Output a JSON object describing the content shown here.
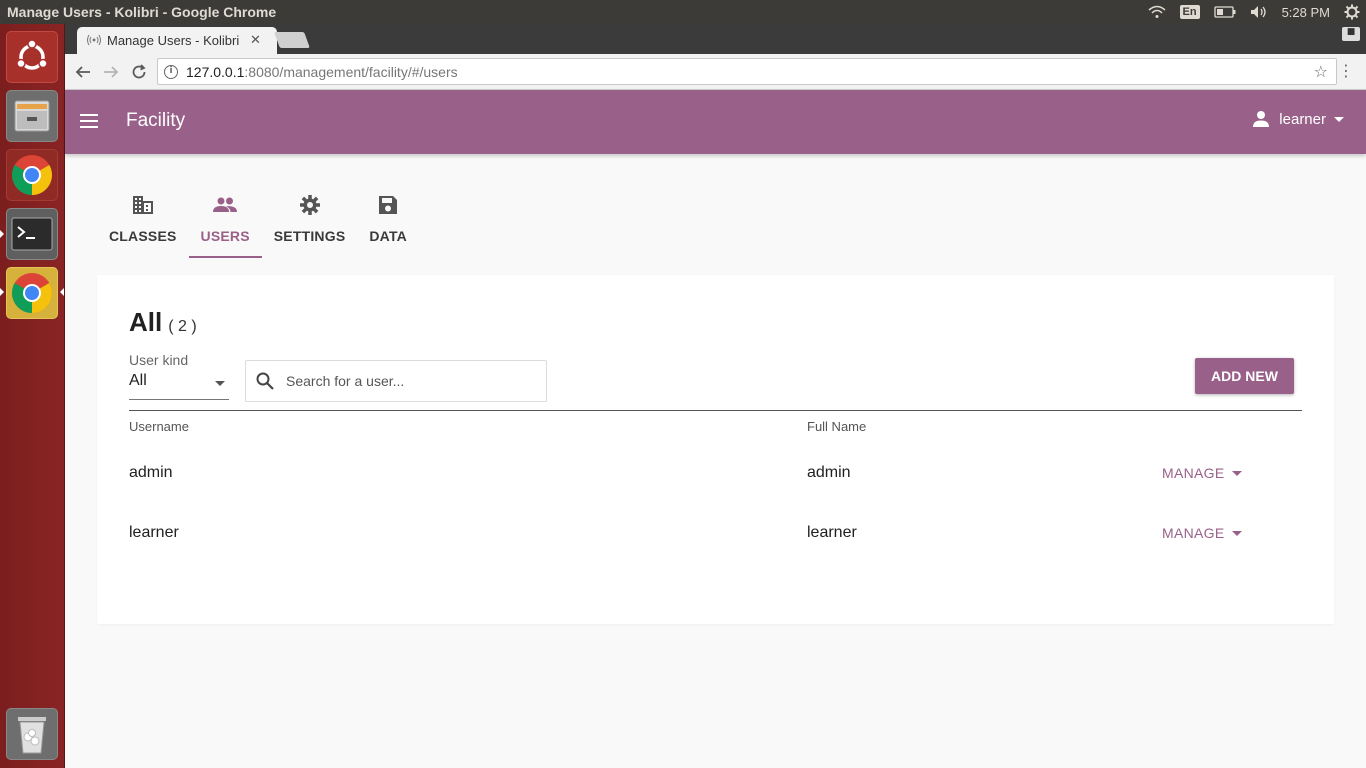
{
  "os": {
    "window_title": "Manage Users - Kolibri - Google Chrome",
    "keyboard_layout": "En",
    "clock": "5:28 PM"
  },
  "browser": {
    "tab_title": "Manage Users - Kolibri",
    "url_host": "127.0.0.1",
    "url_rest": ":8080/management/facility/#/users"
  },
  "app": {
    "title": "Facility",
    "user": "learner",
    "accent": "#996189"
  },
  "tabs": [
    {
      "label": "CLASSES",
      "icon": "building-icon"
    },
    {
      "label": "USERS",
      "icon": "people-icon"
    },
    {
      "label": "SETTINGS",
      "icon": "gear-icon"
    },
    {
      "label": "DATA",
      "icon": "save-icon"
    }
  ],
  "users_panel": {
    "heading": "All",
    "count": "( 2 )",
    "user_kind_label": "User kind",
    "user_kind_value": "All",
    "search_placeholder": "Search for a user...",
    "add_new_label": "ADD NEW",
    "columns": {
      "username": "Username",
      "full_name": "Full Name"
    },
    "rows": [
      {
        "username": "admin",
        "full_name": "admin",
        "action": "MANAGE"
      },
      {
        "username": "learner",
        "full_name": "learner",
        "action": "MANAGE"
      }
    ]
  }
}
